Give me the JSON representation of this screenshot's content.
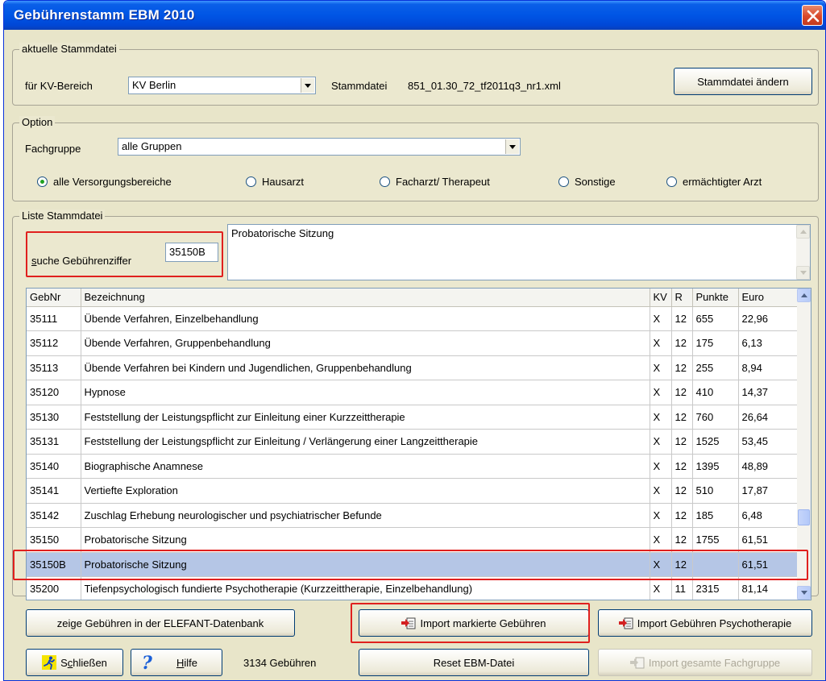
{
  "window": {
    "title": "Gebührenstamm EBM 2010"
  },
  "stammdatei_group": {
    "legend": "aktuelle Stammdatei",
    "kv_label": "für KV-Bereich",
    "kv_value": "KV Berlin",
    "file_label": "Stammdatei",
    "file_value": "851_01.30_72_tf2011q3_nr1.xml",
    "change_button": "Stammdatei ändern"
  },
  "option_group": {
    "legend": "Option",
    "fachgruppe_label": "Fachgruppe",
    "fachgruppe_value": "alle Gruppen",
    "radios": [
      {
        "label": "alle Versorgungsbereiche",
        "checked": true
      },
      {
        "label": "Hausarzt",
        "checked": false
      },
      {
        "label": "Facharzt/ Therapeut",
        "checked": false
      },
      {
        "label": "Sonstige",
        "checked": false
      },
      {
        "label": "ermächtigter Arzt",
        "checked": false
      }
    ]
  },
  "list_group": {
    "legend": "Liste Stammdatei",
    "search_label_prefix": "s",
    "search_label_rest": "uche Gebührenziffer",
    "search_value": "35150B",
    "description": "Probatorische Sitzung"
  },
  "table": {
    "columns": [
      "GebNr",
      "Bezeichnung",
      "KV",
      "R",
      "Punkte",
      "Euro"
    ],
    "rows": [
      {
        "gebnr": "35111",
        "bez": "Übende Verfahren, Einzelbehandlung",
        "kv": "X",
        "r": "12",
        "punkte": "655",
        "euro": "22,96"
      },
      {
        "gebnr": "35112",
        "bez": "Übende Verfahren, Gruppenbehandlung",
        "kv": "X",
        "r": "12",
        "punkte": "175",
        "euro": "6,13"
      },
      {
        "gebnr": "35113",
        "bez": "Übende Verfahren bei Kindern und Jugendlichen, Gruppenbehandlung",
        "kv": "X",
        "r": "12",
        "punkte": "255",
        "euro": "8,94"
      },
      {
        "gebnr": "35120",
        "bez": "Hypnose",
        "kv": "X",
        "r": "12",
        "punkte": "410",
        "euro": "14,37"
      },
      {
        "gebnr": "35130",
        "bez": "Feststellung der Leistungspflicht zur Einleitung einer Kurzzeittherapie",
        "kv": "X",
        "r": "12",
        "punkte": "760",
        "euro": "26,64"
      },
      {
        "gebnr": "35131",
        "bez": "Feststellung der Leistungspflicht zur Einleitung / Verlängerung einer Langzeittherapie",
        "kv": "X",
        "r": "12",
        "punkte": "1525",
        "euro": "53,45"
      },
      {
        "gebnr": "35140",
        "bez": "Biographische Anamnese",
        "kv": "X",
        "r": "12",
        "punkte": "1395",
        "euro": "48,89"
      },
      {
        "gebnr": "35141",
        "bez": "Vertiefte Exploration",
        "kv": "X",
        "r": "12",
        "punkte": "510",
        "euro": "17,87"
      },
      {
        "gebnr": "35142",
        "bez": "Zuschlag Erhebung neurologischer und psychiatrischer Befunde",
        "kv": "X",
        "r": "12",
        "punkte": "185",
        "euro": "6,48"
      },
      {
        "gebnr": "35150",
        "bez": "Probatorische Sitzung",
        "kv": "X",
        "r": "12",
        "punkte": "1755",
        "euro": "61,51"
      },
      {
        "gebnr": "35150B",
        "bez": "Probatorische Sitzung",
        "kv": "X",
        "r": "12",
        "punkte": "",
        "euro": "61,51",
        "selected": true
      },
      {
        "gebnr": "35200",
        "bez": "Tiefenpsychologisch fundierte Psychotherapie (Kurzzeittherapie, Einzelbehandlung)",
        "kv": "X",
        "r": "11",
        "punkte": "2315",
        "euro": "81,14"
      }
    ]
  },
  "buttons": {
    "show_elefant": "zeige Gebühren in der ELEFANT-Datenbank",
    "import_marked": "Import markierte Gebühren",
    "import_psycho": "Import Gebühren Psychotherapie",
    "close_prefix": "S",
    "close_underline": "c",
    "close_rest": "hließen",
    "help_underline": "H",
    "help_rest": "ilfe",
    "reset": "Reset EBM-Datei",
    "import_all": "Import gesamte Fachgruppe"
  },
  "status": {
    "count_text": "3134 Gebühren"
  },
  "colors": {
    "highlight": "#e0201e",
    "selection": "#b5c6e6",
    "title_blue": "#0055e5"
  }
}
